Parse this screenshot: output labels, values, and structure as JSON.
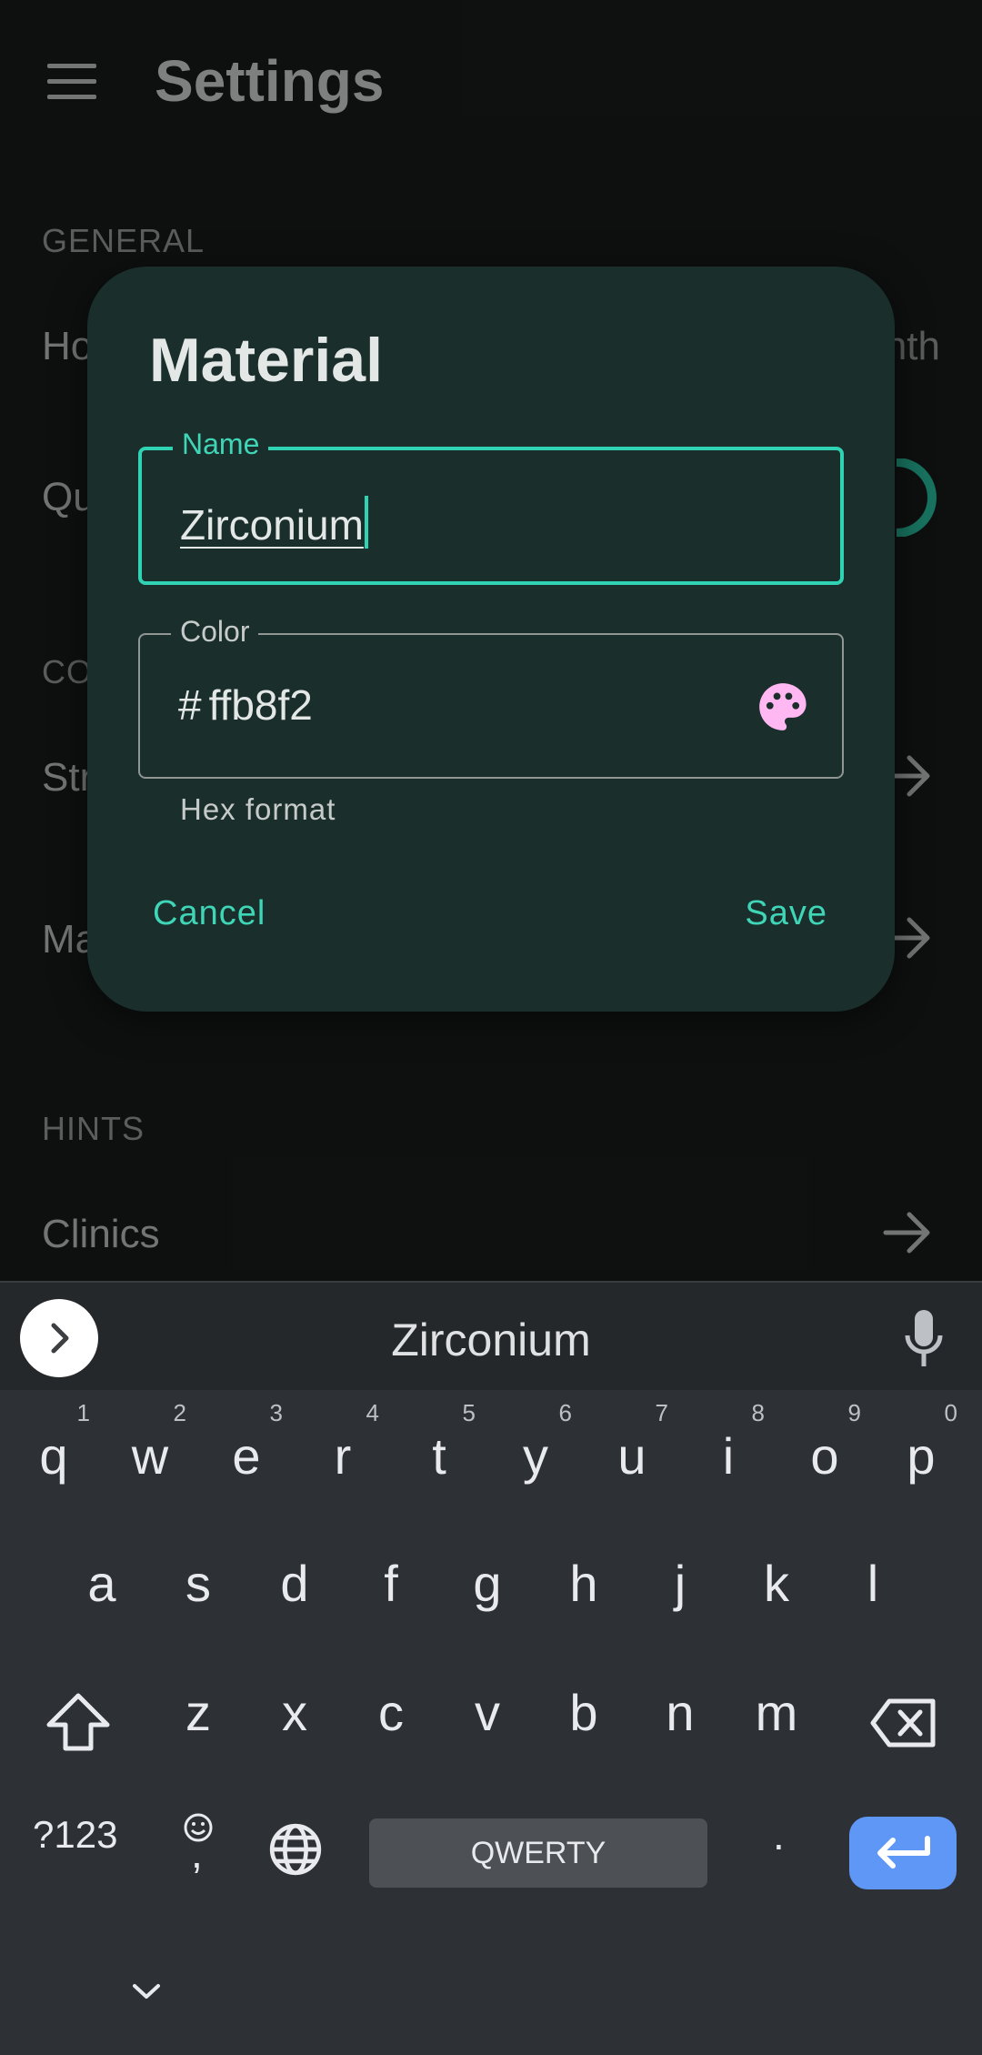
{
  "app_bar": {
    "title": "Settings"
  },
  "sections": [
    {
      "header": "GENERAL"
    },
    {
      "header": "CO"
    },
    {
      "header": "HINTS"
    }
  ],
  "settings": {
    "item1_label": "Ho",
    "item1_value": "nth",
    "item2_label": "Qu",
    "item3_label": "Str",
    "item4_label": "Ma",
    "item5_label": "Clinics"
  },
  "dialog": {
    "title": "Material",
    "name_field": {
      "label": "Name",
      "value": "Zirconium"
    },
    "color_field": {
      "label": "Color",
      "prefix": "#",
      "value": "ffb8f2",
      "helper": "Hex format",
      "swatch_color": "#ffb8f2"
    },
    "cancel_label": "Cancel",
    "save_label": "Save",
    "accent": "#2fd3b3"
  },
  "keyboard": {
    "suggestion": "Zirconium",
    "row1": [
      {
        "key": "q",
        "hint": "1"
      },
      {
        "key": "w",
        "hint": "2"
      },
      {
        "key": "e",
        "hint": "3"
      },
      {
        "key": "r",
        "hint": "4"
      },
      {
        "key": "t",
        "hint": "5"
      },
      {
        "key": "y",
        "hint": "6"
      },
      {
        "key": "u",
        "hint": "7"
      },
      {
        "key": "i",
        "hint": "8"
      },
      {
        "key": "o",
        "hint": "9"
      },
      {
        "key": "p",
        "hint": "0"
      }
    ],
    "row2": [
      "a",
      "s",
      "d",
      "f",
      "g",
      "h",
      "j",
      "k",
      "l"
    ],
    "row3": [
      "z",
      "x",
      "c",
      "v",
      "b",
      "n",
      "m"
    ],
    "symbols_label": "?123",
    "comma_label": ",",
    "space_label": "QWERTY",
    "period_label": ".",
    "enter_color": "#5e97f6"
  }
}
